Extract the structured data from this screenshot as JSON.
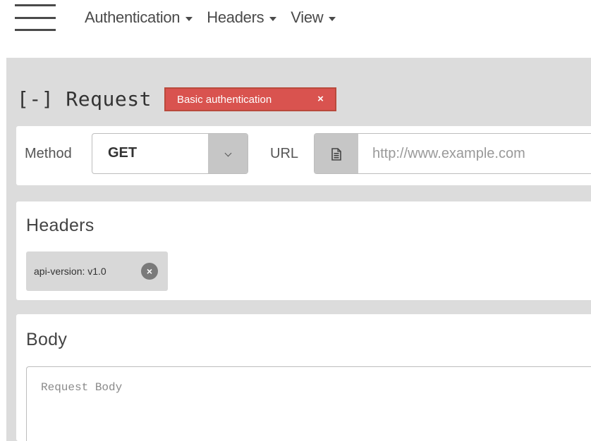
{
  "nav": {
    "menu_icon": "hamburger-icon",
    "items": [
      {
        "label": "Authentication",
        "icon": "caret-down-icon"
      },
      {
        "label": "Headers",
        "icon": "caret-down-icon"
      },
      {
        "label": "View",
        "icon": "caret-down-icon"
      }
    ]
  },
  "request": {
    "title": "[-] Request",
    "auth_badge": {
      "label": "Basic authentication",
      "close": "×"
    },
    "method_label": "Method",
    "method_value": "GET",
    "url_label": "URL",
    "url_icon": "document-icon",
    "url_placeholder": "http://www.example.com"
  },
  "headers": {
    "title": "Headers",
    "chips": [
      {
        "text": "api-version: v1.0",
        "close": "×"
      }
    ]
  },
  "body": {
    "title": "Body",
    "placeholder": "Request Body"
  },
  "colors": {
    "auth_badge": "#d9534f",
    "panel_bg": "#dcdcdc",
    "addon_bg": "#c6c6c6"
  }
}
